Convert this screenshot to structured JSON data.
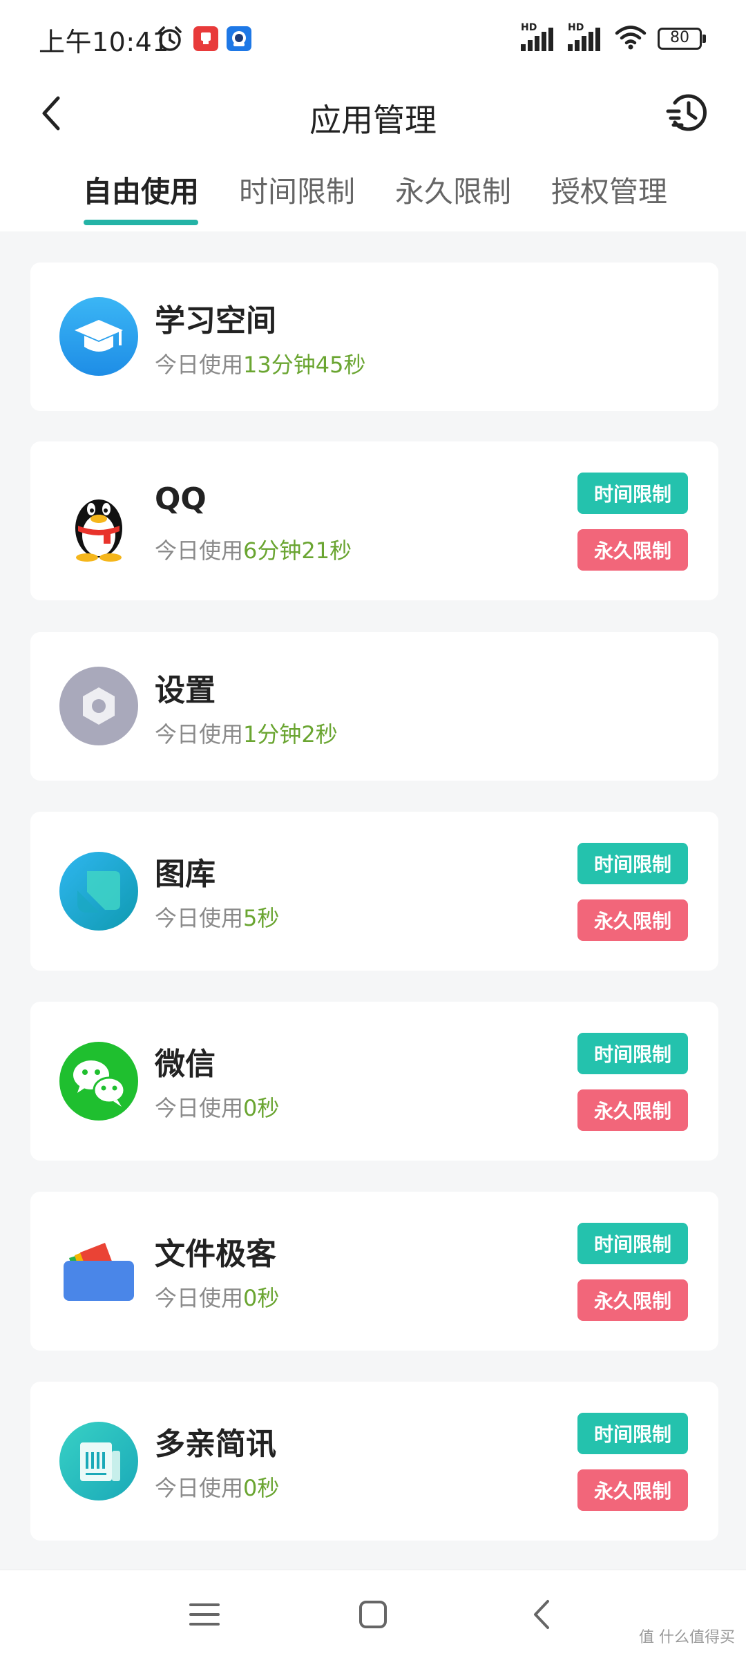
{
  "status_bar": {
    "time": "上午10:41",
    "signal1_label": "HD",
    "signal2_label": "HD",
    "battery": "80"
  },
  "header": {
    "title": "应用管理"
  },
  "tabs": [
    {
      "label": "自由使用",
      "active": true
    },
    {
      "label": "时间限制",
      "active": false
    },
    {
      "label": "永久限制",
      "active": false
    },
    {
      "label": "授权管理",
      "active": false
    }
  ],
  "usage_prefix": "今日使用",
  "buttons": {
    "time_limit": "时间限制",
    "permanent_limit": "永久限制"
  },
  "apps": [
    {
      "name": "学习空间",
      "usage": "13分钟45秒",
      "icon": "graduation-cap-icon",
      "has_buttons": false
    },
    {
      "name": "QQ",
      "usage": "6分钟21秒",
      "icon": "qq-penguin-icon",
      "has_buttons": true
    },
    {
      "name": "设置",
      "usage": "1分钟2秒",
      "icon": "settings-icon",
      "has_buttons": false
    },
    {
      "name": "图库",
      "usage": "5秒",
      "icon": "gallery-icon",
      "has_buttons": true
    },
    {
      "name": "微信",
      "usage": "0秒",
      "icon": "wechat-icon",
      "has_buttons": true
    },
    {
      "name": "文件极客",
      "usage": "0秒",
      "icon": "file-geek-icon",
      "has_buttons": true
    },
    {
      "name": "多亲简讯",
      "usage": "0秒",
      "icon": "duoqin-news-icon",
      "has_buttons": true
    }
  ],
  "watermark": "值 什么值得买",
  "colors": {
    "accent": "#24b3a6",
    "time_limit_button": "#24c2ad",
    "permanent_limit_button": "#f2667a",
    "usage_value": "#6aa531"
  }
}
